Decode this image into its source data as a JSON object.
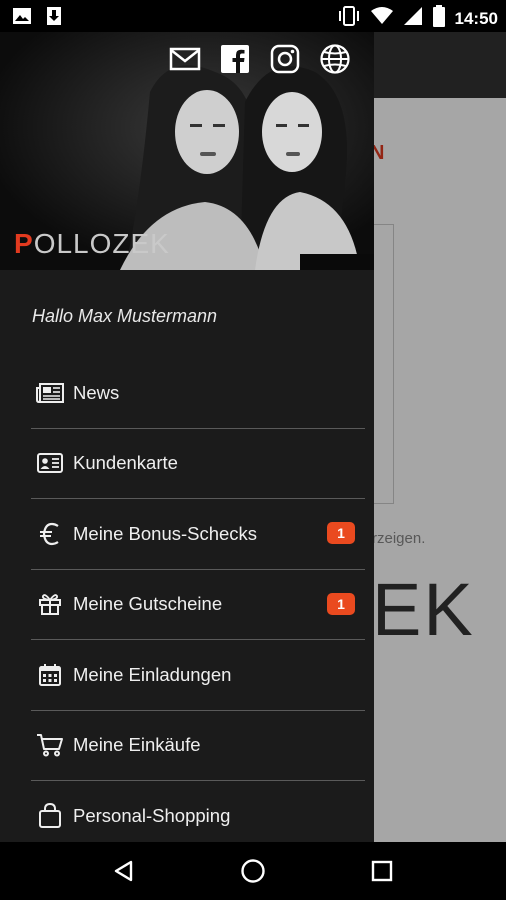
{
  "status_bar": {
    "time": "14:50",
    "left_icons": [
      "image-icon",
      "download-icon"
    ],
    "right_icons": [
      "vibrate-icon",
      "wifi-icon",
      "signal-icon",
      "battery-icon"
    ]
  },
  "background_app": {
    "heading_fragment": "N",
    "text_fragment": "rzeigen.",
    "logo_fragment": "EK"
  },
  "drawer": {
    "social_icons": [
      "mail-icon",
      "facebook-icon",
      "instagram-icon",
      "globe-icon"
    ],
    "brand": {
      "p": "P",
      "rest": "OLLOZEK"
    },
    "greeting": "Hallo Max Mustermann",
    "items": [
      {
        "label": "News",
        "icon": "newspaper-icon",
        "badge": ""
      },
      {
        "label": "Kundenkarte",
        "icon": "id-card-icon",
        "badge": ""
      },
      {
        "label": "Meine Bonus-Schecks",
        "icon": "euro-icon",
        "badge": "1"
      },
      {
        "label": "Meine Gutscheine",
        "icon": "gift-icon",
        "badge": "1"
      },
      {
        "label": "Meine Einladungen",
        "icon": "calendar-icon",
        "badge": ""
      },
      {
        "label": "Meine Einkäufe",
        "icon": "cart-icon",
        "badge": ""
      },
      {
        "label": "Personal-Shopping",
        "icon": "shopping-bag-icon",
        "badge": ""
      }
    ]
  },
  "nav_bar": {
    "icons": [
      "back-icon",
      "home-icon",
      "recents-icon"
    ]
  },
  "colors": {
    "accent": "#e23a1f",
    "badge": "#ea4a1f",
    "drawer_bg": "#1b1b1b",
    "divider": "#5a5a5a"
  }
}
